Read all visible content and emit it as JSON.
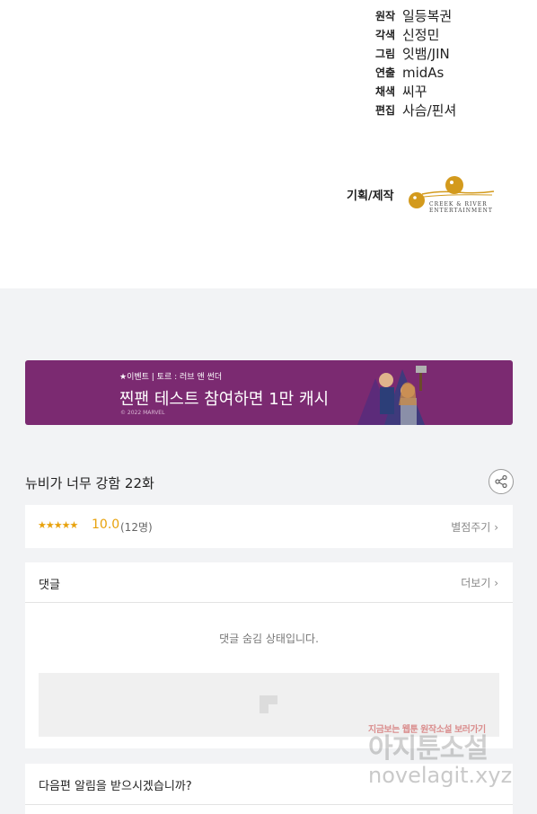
{
  "credits": [
    {
      "role": "원작",
      "name": "일등복권"
    },
    {
      "role": "각색",
      "name": "신정민"
    },
    {
      "role": "그림",
      "name": "잇뱀/JIN"
    },
    {
      "role": "연출",
      "name": "midAs"
    },
    {
      "role": "채색",
      "name": "씨꾸"
    },
    {
      "role": "편집",
      "name": "사슴/핀셔"
    }
  ],
  "production": {
    "label": "기획/제작",
    "logo_text_1": "CREEK & RIVER",
    "logo_text_2": "ENTERTAINMENT",
    "logo_color": "#d39a1d"
  },
  "banner": {
    "small_text": "★이벤트 | 토르 : 러브 앤 썬더",
    "big_text": "찐팬 테스트 참여하면 1만 캐시!",
    "copyright": "© 2022 MARVEL",
    "bg_color": "#7b2a71"
  },
  "episode": {
    "title": "뉴비가 너무 강함 22화",
    "share_icon": "share-icon"
  },
  "rating": {
    "stars": "★★★★★",
    "value": "10.0",
    "count": "(12명)",
    "rate_link": "별점주기",
    "star_color": "#e8a20c"
  },
  "comments": {
    "title": "댓글",
    "more": "더보기",
    "hidden_message": "댓글 숨김 상태입니다."
  },
  "notify": {
    "text": "다음편 알림을 받으시겠습니까?"
  },
  "watermark": {
    "line1": "지금보는 웹툰 원작소설 보러가기",
    "line2": "아지툰소설",
    "line3": "novelagit.xyz"
  }
}
